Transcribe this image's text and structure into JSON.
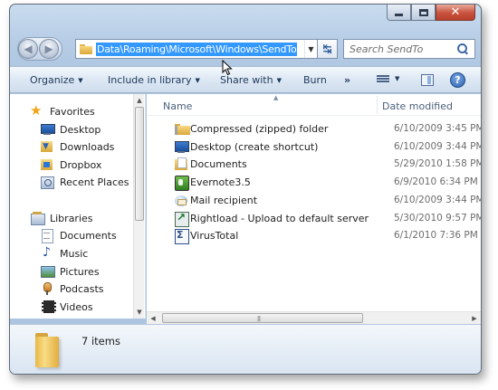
{
  "window": {
    "address_path": "Data\\Roaming\\Microsoft\\Windows\\SendTo",
    "search_placeholder": "Search SendTo"
  },
  "toolbar": {
    "organize": "Organize",
    "include_in_library": "Include in library",
    "share_with": "Share with",
    "burn": "Burn",
    "more": "»"
  },
  "sidebar": {
    "favorites": {
      "label": "Favorites",
      "items": [
        {
          "label": "Desktop",
          "icon": "desktop-icon"
        },
        {
          "label": "Downloads",
          "icon": "downloads-folder-icon"
        },
        {
          "label": "Dropbox",
          "icon": "dropbox-folder-icon"
        },
        {
          "label": "Recent Places",
          "icon": "recent-places-icon"
        }
      ]
    },
    "libraries": {
      "label": "Libraries",
      "items": [
        {
          "label": "Documents",
          "icon": "documents-icon"
        },
        {
          "label": "Music",
          "icon": "music-icon"
        },
        {
          "label": "Pictures",
          "icon": "pictures-icon"
        },
        {
          "label": "Podcasts",
          "icon": "podcasts-icon"
        },
        {
          "label": "Videos",
          "icon": "videos-icon"
        }
      ]
    }
  },
  "columns": {
    "name": "Name",
    "date_modified": "Date modified"
  },
  "files": [
    {
      "name": "Compressed (zipped) folder",
      "date": "6/10/2009 3:45 PM",
      "icon": "zip-folder-icon"
    },
    {
      "name": "Desktop (create shortcut)",
      "date": "6/10/2009 3:44 PM",
      "icon": "desktop-shortcut-icon"
    },
    {
      "name": "Documents",
      "date": "5/29/2010 1:58 PM",
      "icon": "documents-folder-icon"
    },
    {
      "name": "Evernote3.5",
      "date": "6/9/2010 6:34 PM",
      "icon": "evernote-icon"
    },
    {
      "name": "Mail recipient",
      "date": "6/10/2009 3:44 PM",
      "icon": "mail-recipient-icon"
    },
    {
      "name": "Rightload - Upload to default server",
      "date": "5/30/2010 9:57 PM",
      "icon": "rightload-icon"
    },
    {
      "name": "VirusTotal",
      "date": "6/1/2010 7:36 PM",
      "icon": "virustotal-icon"
    }
  ],
  "details": {
    "items_count": "7 items"
  }
}
